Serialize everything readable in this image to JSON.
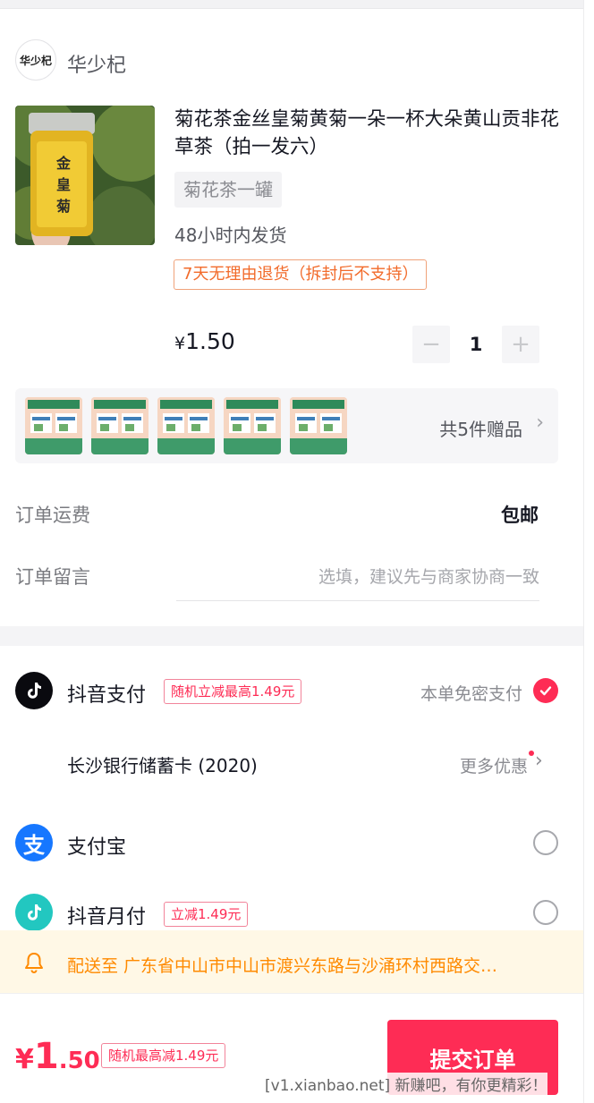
{
  "shop": {
    "logo_text": "华少杞",
    "name": "华少杞"
  },
  "product": {
    "title": "菊花茶金丝皇菊黄菊一朵一杯大朵黄山贡非花草茶（拍一发六）",
    "sku": "菊花茶一罐",
    "ship_time": "48小时内发货",
    "return_policy": "7天无理由退货（拆封后不支持）",
    "price_symbol": "¥",
    "price_value": "1.50",
    "quantity": "1",
    "minus": "−",
    "plus": "+"
  },
  "gifts": {
    "thumb_count": 5,
    "label": "共5件赠品",
    "chevron": "›"
  },
  "order": {
    "freight_label": "订单运费",
    "freight_value": "包邮",
    "note_label": "订单留言",
    "note_placeholder": "选填，建议先与商家协商一致"
  },
  "payment": {
    "douyin_pay": {
      "name": "抖音支付",
      "promo": "随机立减最高1.49元",
      "no_password": "本单免密支付",
      "selected": true
    },
    "bank_card": {
      "name": "长沙银行储蓄卡 (2020)",
      "more_offers": "更多优惠"
    },
    "alipay": {
      "name": "支付宝",
      "icon_glyph": "支"
    },
    "douyin_monthly": {
      "name": "抖音月付",
      "promo": "立减1.49元"
    }
  },
  "address": {
    "text": "配送至 广东省中山市中山市渡兴东路与沙涌环村西路交…"
  },
  "bottom": {
    "yen": "¥",
    "total_int": "1",
    "total_dec": ".50",
    "discount_tag": "随机最高减1.49元",
    "submit_label": "提交订单"
  },
  "watermark": "[v1.xianbao.net] 新赚吧，有你更精彩！",
  "colors": {
    "accent": "#fe2c55",
    "warning": "#ff8a00",
    "return_tag": "#f26b2b",
    "alipay": "#1677ff",
    "douyin_monthly": "#22c7c0"
  },
  "icons": [
    "douyin-icon",
    "alipay-icon",
    "douyin-monthly-icon",
    "bell-icon",
    "check-icon",
    "chevron-right-icon"
  ]
}
